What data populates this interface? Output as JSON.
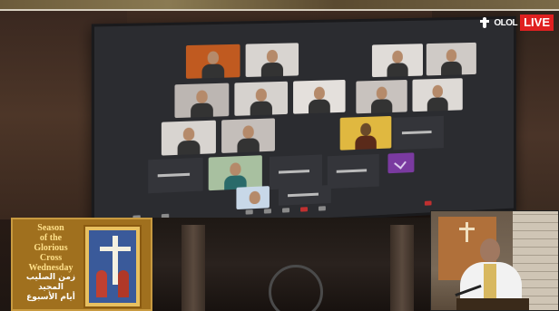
{
  "overlay": {
    "logo_name": "OLOL",
    "live_label": "LIVE"
  },
  "season_panel": {
    "lines_en": [
      "Season",
      "of the",
      "Glorious",
      "Cross",
      "Wednesday"
    ],
    "lines_ar": [
      "زمن الصليب",
      "المجيد",
      "أيام الأسبوع"
    ]
  },
  "icons": {
    "logo": "cross-figure-icon",
    "season_icon": "cross-icon",
    "video_call": "video-grid-icon"
  },
  "colors": {
    "live_badge": "#e02020",
    "panel_bg": "#a0701e",
    "panel_text": "#ffe08a"
  }
}
